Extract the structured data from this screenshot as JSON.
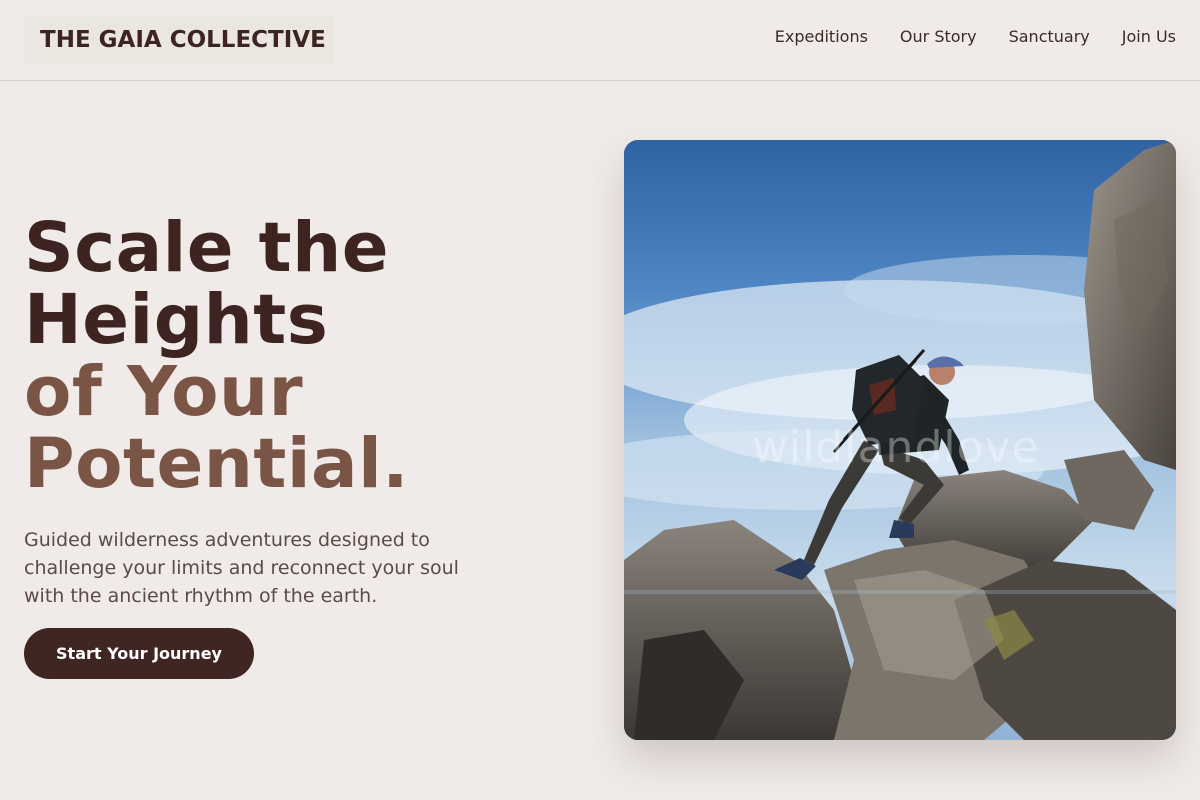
{
  "brand": {
    "name": "THE GAIA COLLECTIVE"
  },
  "nav": {
    "items": [
      {
        "label": "Expeditions"
      },
      {
        "label": "Our Story"
      },
      {
        "label": "Sanctuary"
      },
      {
        "label": "Join Us"
      }
    ]
  },
  "hero": {
    "title_line1": "Scale the",
    "title_line2": "Heights",
    "title_line3": "of Your",
    "title_line4": "Potential.",
    "subtitle": "Guided wilderness adventures designed to challenge your limits and reconnect your soul with the ancient rhythm of the earth.",
    "cta_label": "Start Your Journey",
    "image_watermark": "wildlandlove",
    "image_alt": "Hiker with backpack climbing over large boulders under a blue sky"
  },
  "colors": {
    "background": "#f0ebe9",
    "primary_dark": "#3d2420",
    "accent_brown": "#7a5546",
    "body_text": "#5b4a46",
    "button_bg": "#3f2622",
    "button_text": "#ffffff"
  }
}
